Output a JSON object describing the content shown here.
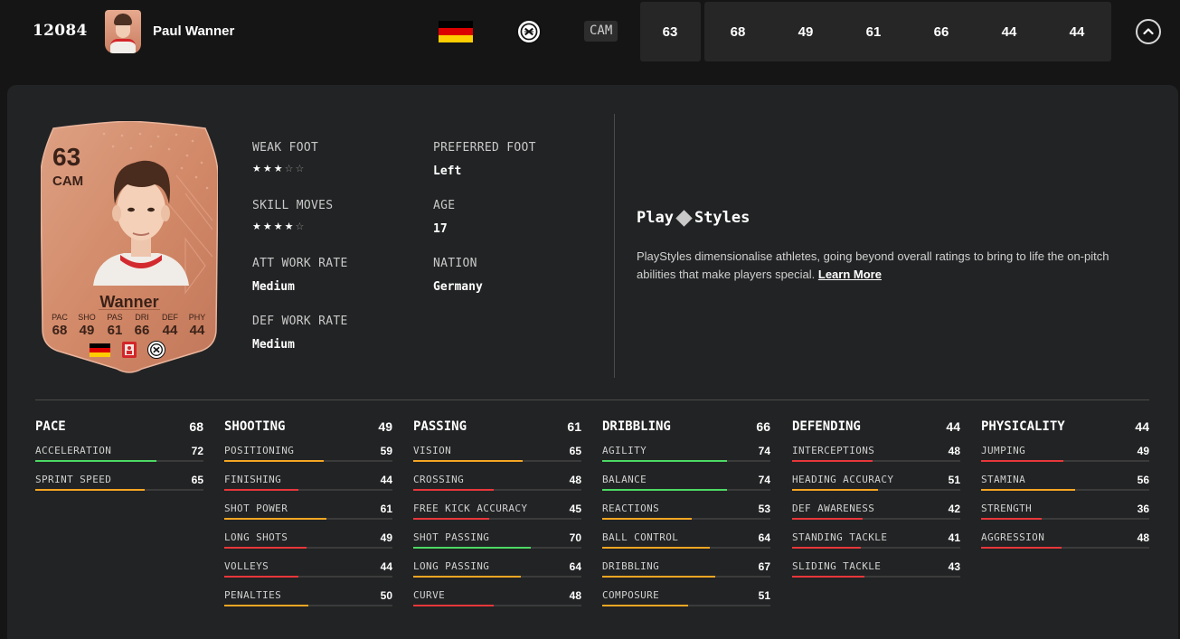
{
  "top": {
    "rank": "12084",
    "name": "Paul Wanner",
    "position": "CAM",
    "overall": "63",
    "stats": [
      "68",
      "49",
      "61",
      "66",
      "44",
      "44"
    ]
  },
  "card": {
    "overall": "63",
    "position": "CAM",
    "name": "Wanner",
    "stat_labels": [
      "PAC",
      "SHO",
      "PAS",
      "DRI",
      "DEF",
      "PHY"
    ],
    "stat_values": [
      "68",
      "49",
      "61",
      "66",
      "44",
      "44"
    ]
  },
  "info": {
    "weak_foot_label": "WEAK FOOT",
    "weak_foot_stars": 3,
    "skill_moves_label": "SKILL MOVES",
    "skill_moves_stars": 4,
    "att_work_rate_label": "ATT WORK RATE",
    "att_work_rate": "Medium",
    "def_work_rate_label": "DEF WORK RATE",
    "def_work_rate": "Medium",
    "preferred_foot_label": "PREFERRED FOOT",
    "preferred_foot": "Left",
    "age_label": "AGE",
    "age": "17",
    "nation_label": "NATION",
    "nation": "Germany"
  },
  "playstyles": {
    "title_left": "Play",
    "title_right": "Styles",
    "description": "PlayStyles dimensionalise athletes, going beyond overall ratings to bring to life the on-pitch abilities that make players special.",
    "link": "Learn More"
  },
  "colors": {
    "high": "#4cd964",
    "mid": "#f5a623",
    "low": "#e8373b",
    "card": "#d38a6b"
  },
  "icons": [
    "germany-flag-icon",
    "club-crest-icon",
    "bundesliga-logo-icon",
    "chevron-up-icon",
    "star-icon",
    "playstyles-diamond-icon"
  ],
  "attributes": [
    {
      "name": "PACE",
      "value": "68",
      "items": [
        {
          "name": "ACCELERATION",
          "value": "72"
        },
        {
          "name": "SPRINT SPEED",
          "value": "65"
        }
      ]
    },
    {
      "name": "SHOOTING",
      "value": "49",
      "items": [
        {
          "name": "POSITIONING",
          "value": "59"
        },
        {
          "name": "FINISHING",
          "value": "44"
        },
        {
          "name": "SHOT POWER",
          "value": "61"
        },
        {
          "name": "LONG SHOTS",
          "value": "49"
        },
        {
          "name": "VOLLEYS",
          "value": "44"
        },
        {
          "name": "PENALTIES",
          "value": "50"
        }
      ]
    },
    {
      "name": "PASSING",
      "value": "61",
      "items": [
        {
          "name": "VISION",
          "value": "65"
        },
        {
          "name": "CROSSING",
          "value": "48"
        },
        {
          "name": "FREE KICK ACCURACY",
          "value": "45"
        },
        {
          "name": "SHOT PASSING",
          "value": "70"
        },
        {
          "name": "LONG PASSING",
          "value": "64"
        },
        {
          "name": "CURVE",
          "value": "48"
        }
      ]
    },
    {
      "name": "DRIBBLING",
      "value": "66",
      "items": [
        {
          "name": "AGILITY",
          "value": "74"
        },
        {
          "name": "BALANCE",
          "value": "74"
        },
        {
          "name": "REACTIONS",
          "value": "53"
        },
        {
          "name": "BALL CONTROL",
          "value": "64"
        },
        {
          "name": "DRIBBLING",
          "value": "67"
        },
        {
          "name": "COMPOSURE",
          "value": "51"
        }
      ]
    },
    {
      "name": "DEFENDING",
      "value": "44",
      "items": [
        {
          "name": "INTERCEPTIONS",
          "value": "48"
        },
        {
          "name": "HEADING ACCURACY",
          "value": "51"
        },
        {
          "name": "DEF AWARENESS",
          "value": "42"
        },
        {
          "name": "STANDING TACKLE",
          "value": "41"
        },
        {
          "name": "SLIDING TACKLE",
          "value": "43"
        }
      ]
    },
    {
      "name": "PHYSICALITY",
      "value": "44",
      "items": [
        {
          "name": "JUMPING",
          "value": "49"
        },
        {
          "name": "STAMINA",
          "value": "56"
        },
        {
          "name": "STRENGTH",
          "value": "36"
        },
        {
          "name": "AGGRESSION",
          "value": "48"
        }
      ]
    }
  ]
}
